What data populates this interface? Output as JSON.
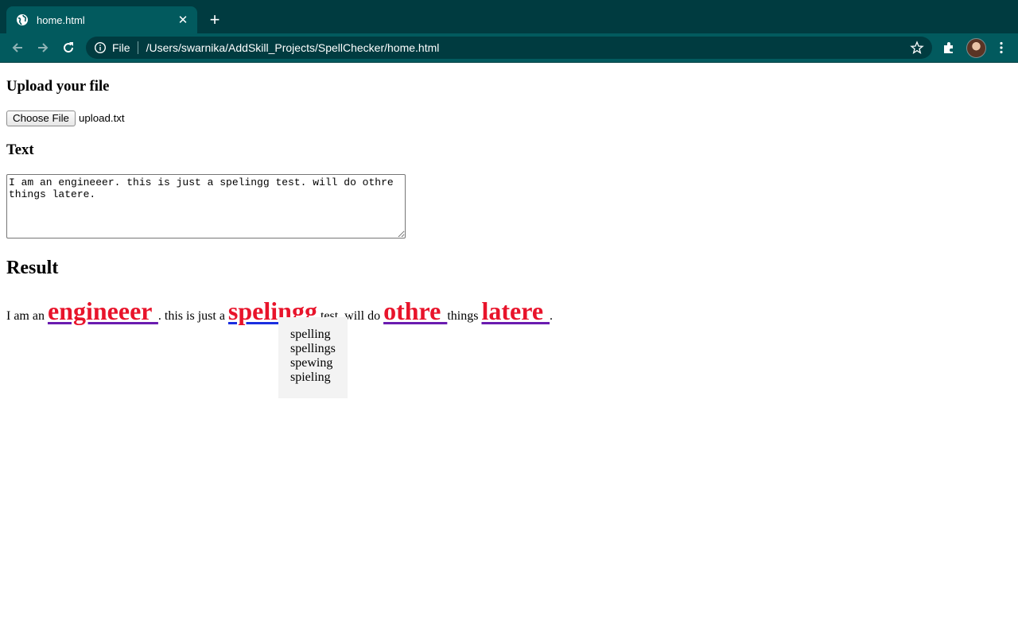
{
  "browser": {
    "tab_title": "home.html",
    "new_tab_symbol": "+",
    "close_symbol": "✕",
    "address_scheme": "File",
    "address_url": "/Users/swarnika/AddSkill_Projects/SpellChecker/home.html",
    "theme_colors": {
      "tabbar": "#003b40",
      "toolbar": "#025a5e",
      "omnibox": "#003b40"
    }
  },
  "page": {
    "upload_heading": "Upload your file",
    "choose_file_label": "Choose File",
    "file_name": "upload.txt",
    "text_heading": "Text",
    "textarea_value": "I am an engineeer. this is just a spelingg test. will do othre things latere.",
    "result_heading": "Result",
    "result_tokens": [
      {
        "text": "I am an ",
        "misspelled": false
      },
      {
        "text": "engineeer ",
        "misspelled": true
      },
      {
        "text": ". this is just a ",
        "misspelled": false
      },
      {
        "text": "spelingg",
        "misspelled": true
      },
      {
        "text": " test. will do ",
        "misspelled": false
      },
      {
        "text": "othre ",
        "misspelled": true
      },
      {
        "text": "things ",
        "misspelled": false
      },
      {
        "text": "latere ",
        "misspelled": true
      },
      {
        "text": ".",
        "misspelled": false
      }
    ],
    "misspelled_color": "#e8142b",
    "suggestions": [
      "spelling",
      "spellings",
      "spewing",
      "spieling"
    ]
  }
}
